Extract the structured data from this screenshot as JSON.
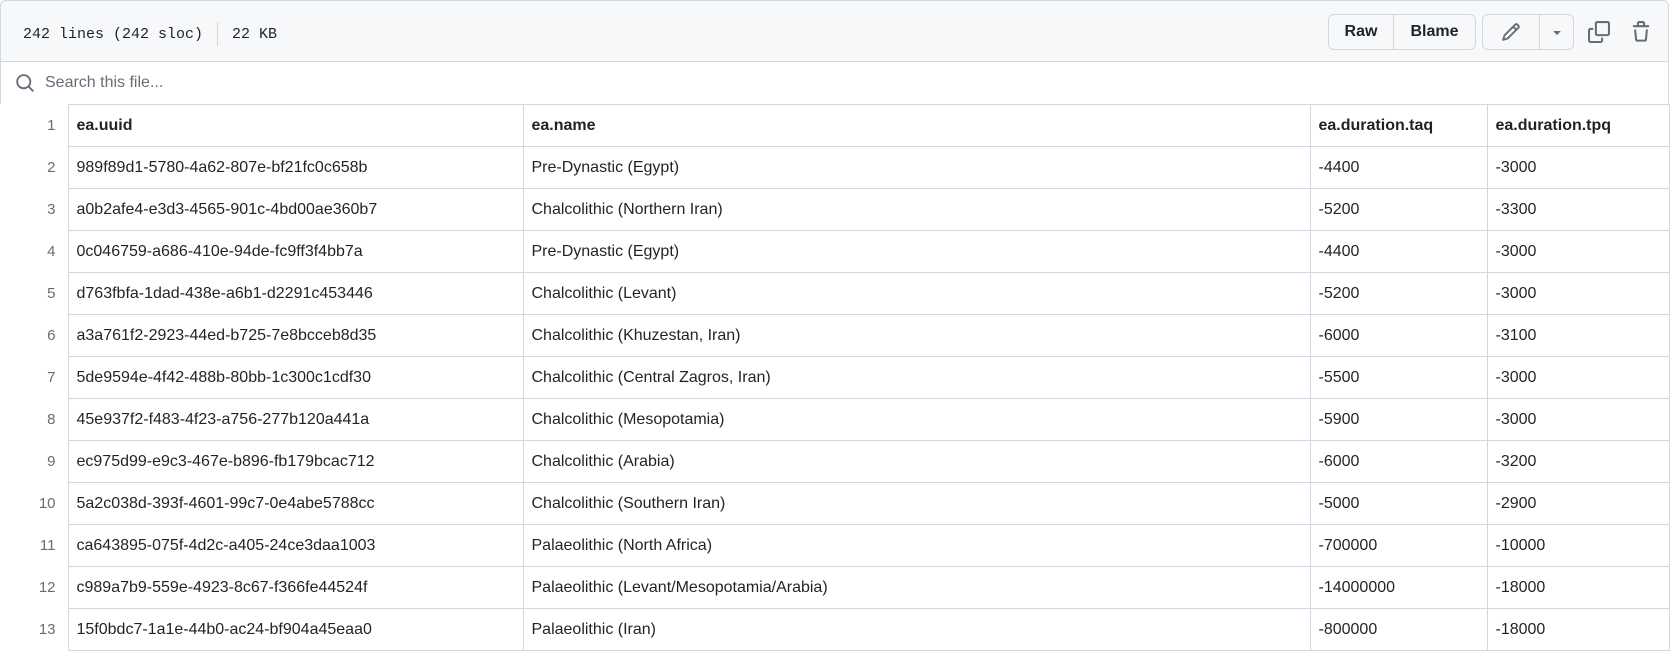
{
  "file_header": {
    "lines_info": "242 lines (242 sloc)",
    "size": "22 KB",
    "raw_label": "Raw",
    "blame_label": "Blame"
  },
  "search": {
    "placeholder": "Search this file..."
  },
  "table": {
    "columns": [
      "ea.uuid",
      "ea.name",
      "ea.duration.taq",
      "ea.duration.tpq"
    ],
    "header_line": "1",
    "rows": [
      {
        "line": "2",
        "uuid": "989f89d1-5780-4a62-807e-bf21fc0c658b",
        "name": "Pre-Dynastic (Egypt)",
        "taq": "-4400",
        "tpq": "-3000"
      },
      {
        "line": "3",
        "uuid": "a0b2afe4-e3d3-4565-901c-4bd00ae360b7",
        "name": "Chalcolithic (Northern Iran)",
        "taq": "-5200",
        "tpq": "-3300"
      },
      {
        "line": "4",
        "uuid": "0c046759-a686-410e-94de-fc9ff3f4bb7a",
        "name": "Pre-Dynastic (Egypt)",
        "taq": "-4400",
        "tpq": "-3000"
      },
      {
        "line": "5",
        "uuid": "d763fbfa-1dad-438e-a6b1-d2291c453446",
        "name": "Chalcolithic (Levant)",
        "taq": "-5200",
        "tpq": "-3000"
      },
      {
        "line": "6",
        "uuid": "a3a761f2-2923-44ed-b725-7e8bcceb8d35",
        "name": "Chalcolithic (Khuzestan, Iran)",
        "taq": "-6000",
        "tpq": "-3100"
      },
      {
        "line": "7",
        "uuid": "5de9594e-4f42-488b-80bb-1c300c1cdf30",
        "name": "Chalcolithic (Central Zagros, Iran)",
        "taq": "-5500",
        "tpq": "-3000"
      },
      {
        "line": "8",
        "uuid": "45e937f2-f483-4f23-a756-277b120a441a",
        "name": "Chalcolithic (Mesopotamia)",
        "taq": "-5900",
        "tpq": "-3000"
      },
      {
        "line": "9",
        "uuid": "ec975d99-e9c3-467e-b896-fb179bcac712",
        "name": "Chalcolithic (Arabia)",
        "taq": "-6000",
        "tpq": "-3200"
      },
      {
        "line": "10",
        "uuid": "5a2c038d-393f-4601-99c7-0e4abe5788cc",
        "name": "Chalcolithic (Southern Iran)",
        "taq": "-5000",
        "tpq": "-2900"
      },
      {
        "line": "11",
        "uuid": "ca643895-075f-4d2c-a405-24ce3daa1003",
        "name": "Palaeolithic (North Africa)",
        "taq": "-700000",
        "tpq": "-10000"
      },
      {
        "line": "12",
        "uuid": "c989a7b9-559e-4923-8c67-f366fe44524f",
        "name": "Palaeolithic (Levant/Mesopotamia/Arabia)",
        "taq": "-14000000",
        "tpq": "-18000"
      },
      {
        "line": "13",
        "uuid": "15f0bdc7-1a1e-44b0-ac24-bf904a45eaa0",
        "name": "Palaeolithic (Iran)",
        "taq": "-800000",
        "tpq": "-18000"
      }
    ]
  },
  "icons": {
    "edit": "pencil-icon",
    "dropdown": "triangle-down-icon",
    "copy": "copy-icon",
    "delete": "trash-icon",
    "search": "search-icon"
  }
}
